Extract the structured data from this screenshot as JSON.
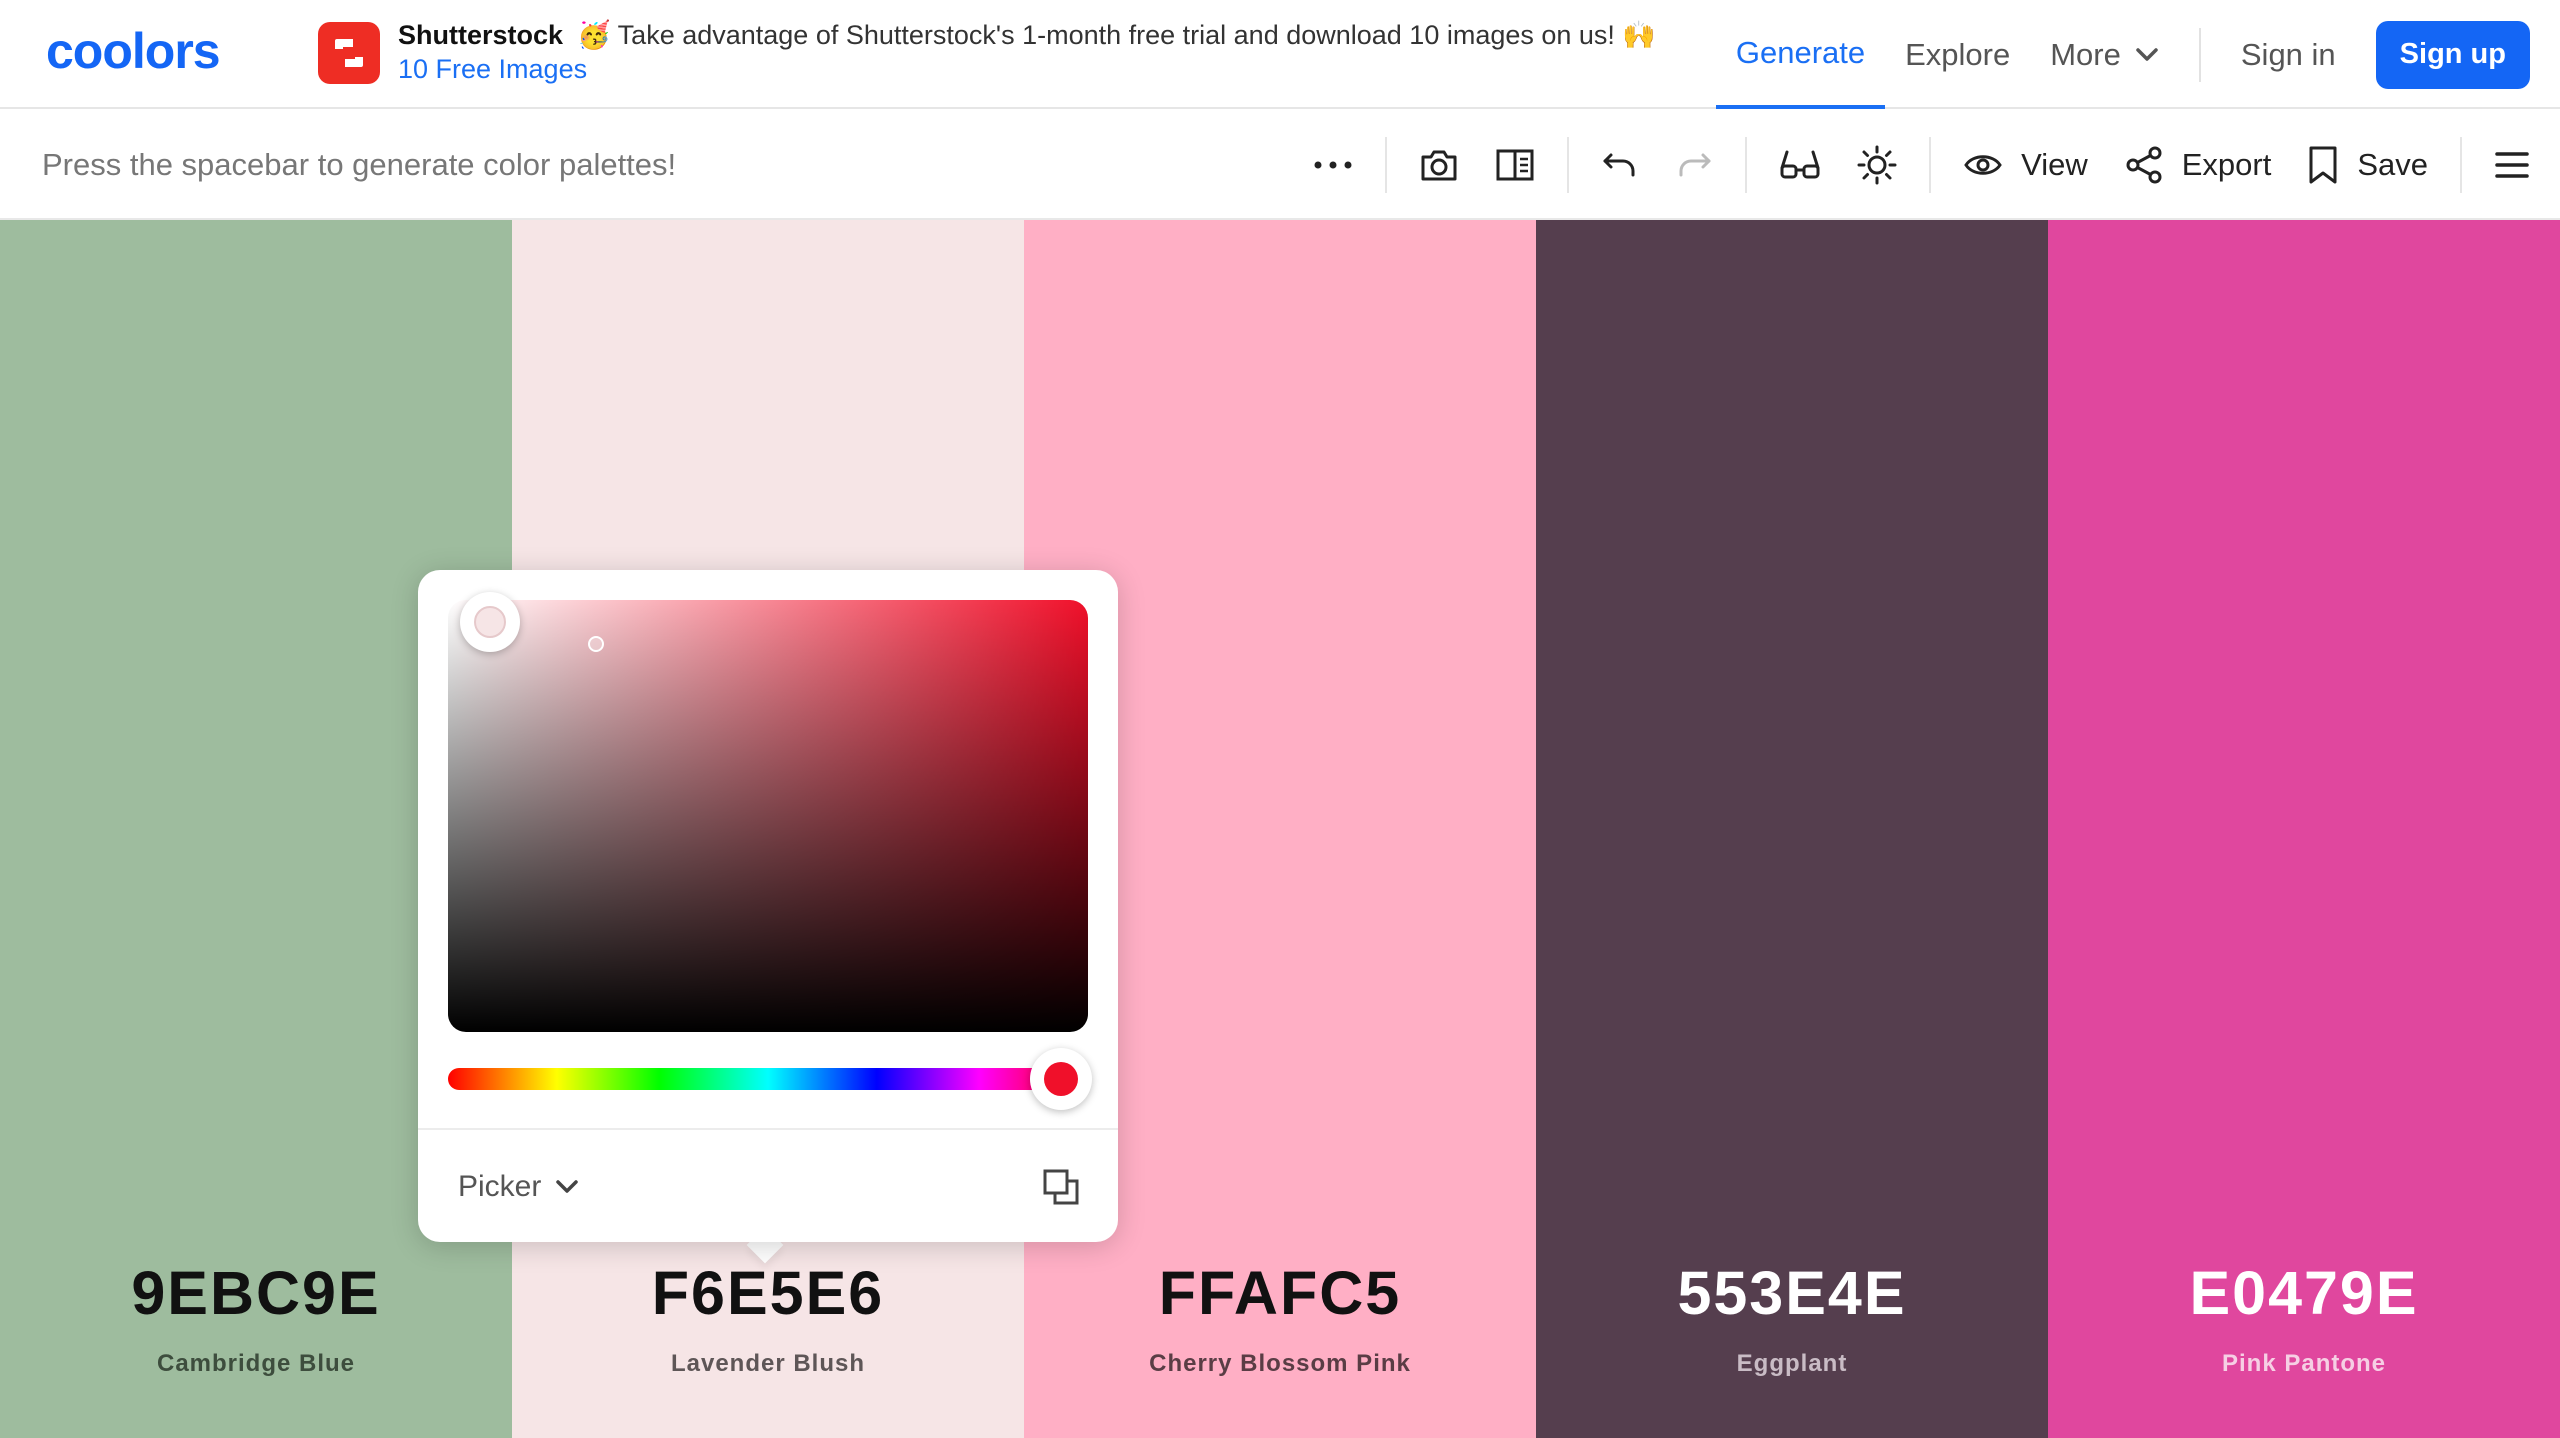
{
  "brand": {
    "logo_text": "coolors",
    "logo_color": "#1466f5"
  },
  "ad": {
    "brand": "Shutterstock",
    "message": "🥳 Take advantage of Shutterstock's 1-month free trial and download 10 images on us! 🙌",
    "link": "10 Free Images",
    "logo_color": "#ee2d24"
  },
  "nav": {
    "generate": "Generate",
    "explore": "Explore",
    "more": "More",
    "sign_in": "Sign in",
    "sign_up": "Sign up"
  },
  "toolbar": {
    "hint": "Press the spacebar to generate color palettes!",
    "view": "View",
    "export": "Export",
    "save": "Save",
    "icons": [
      "more-icon",
      "camera-icon",
      "panel-icon",
      "undo-icon",
      "redo-icon",
      "glasses-icon",
      "sun-icon",
      "eye-icon",
      "share-icon",
      "bookmark-icon",
      "hamburger-icon"
    ]
  },
  "palette": [
    {
      "hex": "9EBC9E",
      "name": "Cambridge Blue",
      "color": "#9ebc9e",
      "hex_color": "#111111",
      "name_color": "#3d4d3d"
    },
    {
      "hex": "F6E5E6",
      "name": "Lavender Blush",
      "color": "#f6e5e6",
      "hex_color": "#111111",
      "name_color": "#5e5657"
    },
    {
      "hex": "FFAFC5",
      "name": "Cherry Blossom Pink",
      "color": "#ffafc5",
      "hex_color": "#111111",
      "name_color": "#5a3d45"
    },
    {
      "hex": "553E4E",
      "name": "Eggplant",
      "color": "#553e4e",
      "hex_color": "#ffffff",
      "name_color": "#c9bcc5"
    },
    {
      "hex": "E0479E",
      "name": "Pink Pantone",
      "color": "#e0479e",
      "hex_color": "#ffffff",
      "name_color": "#f6cfe4"
    }
  ],
  "picker": {
    "mode": "Picker",
    "hue_color": "#f0102a",
    "selected_color": "#f6e5e6"
  }
}
